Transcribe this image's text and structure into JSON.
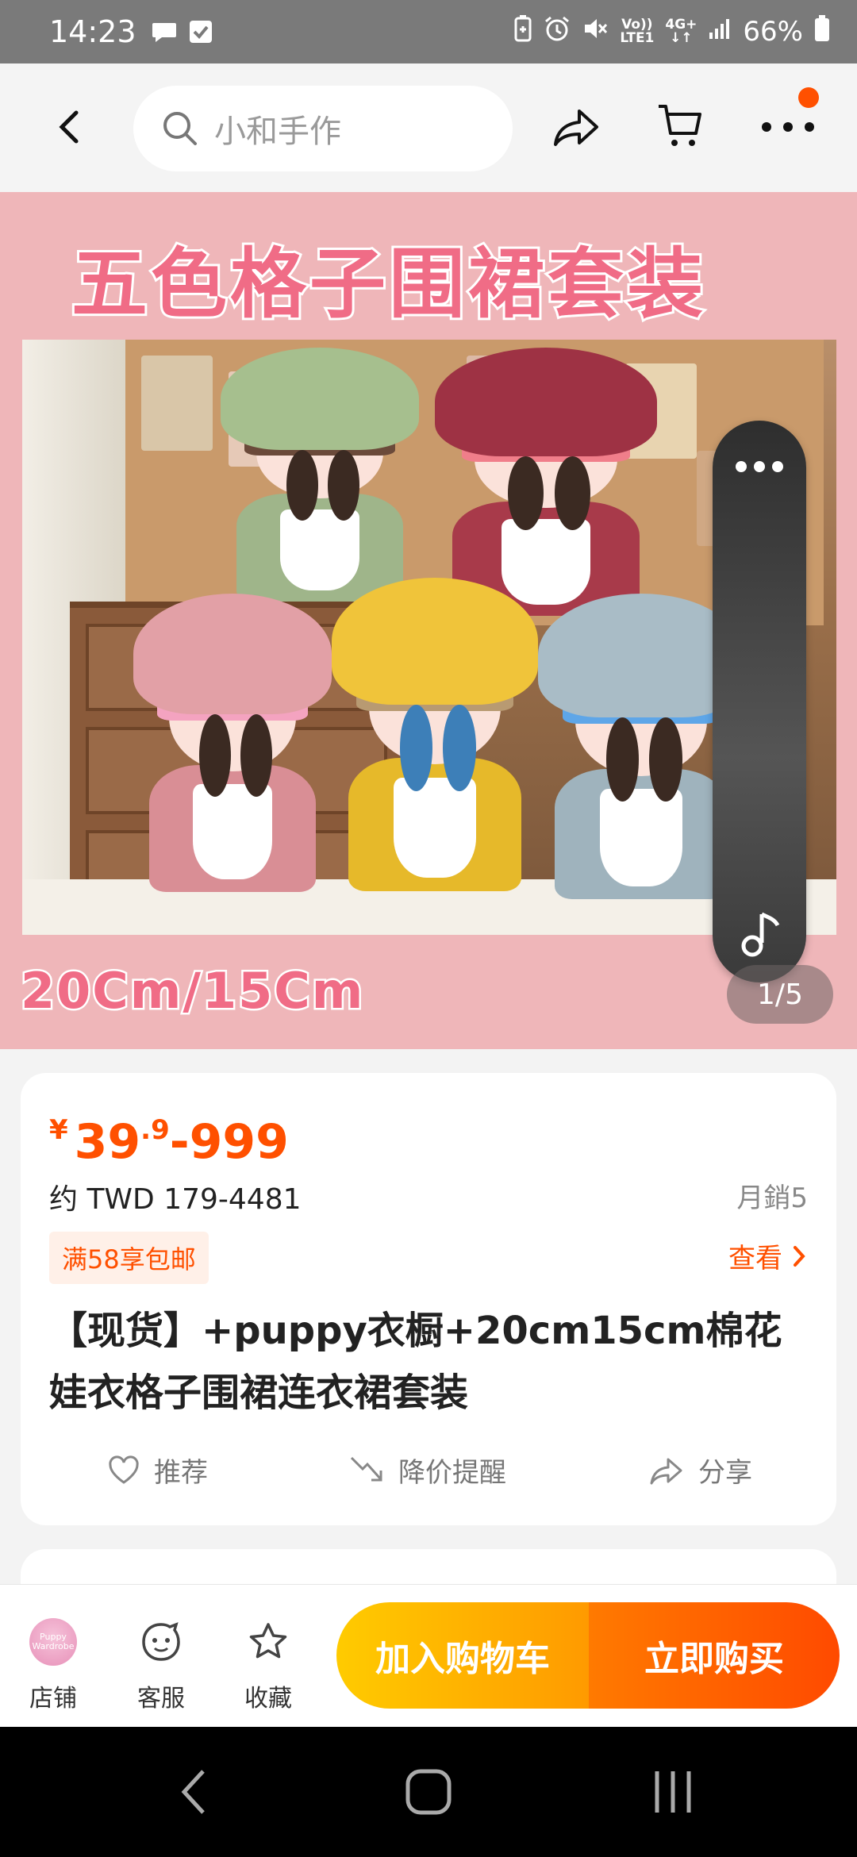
{
  "status_bar": {
    "time": "14:23",
    "network_top": "Vo))",
    "network_bottom": "LTE1",
    "signal_label": "4G+",
    "battery": "66%"
  },
  "search": {
    "placeholder": "小和手作"
  },
  "gallery": {
    "banner_title": "五色格子围裙套装",
    "banner_size": "20Cm/15Cm",
    "pager": "1/5"
  },
  "product": {
    "currency": "¥",
    "price_main": "39",
    "price_decimal": ".9",
    "price_range_end": "-999",
    "converted_price": "约 TWD 179-4481",
    "monthly_sales": "月銷5",
    "shipping_badge": "满58享包邮",
    "view_label": "查看",
    "title": "【现货】+puppy衣橱+20cm15cm棉花娃衣格子围裙连衣裙套装",
    "actions": {
      "recommend": "推荐",
      "price_alert": "降价提醒",
      "share": "分享"
    }
  },
  "bottom_bar": {
    "shop_label": "店铺",
    "shop_avatar_text": "Puppy Wardrobe",
    "service_label": "客服",
    "favorite_label": "收藏",
    "add_to_cart": "加入购物车",
    "buy_now": "立即购买"
  },
  "colors": {
    "accent": "#ff5000",
    "cart_button": "#ffb400",
    "buy_button": "#ff5a00",
    "banner_bg": "#efb6b9"
  }
}
